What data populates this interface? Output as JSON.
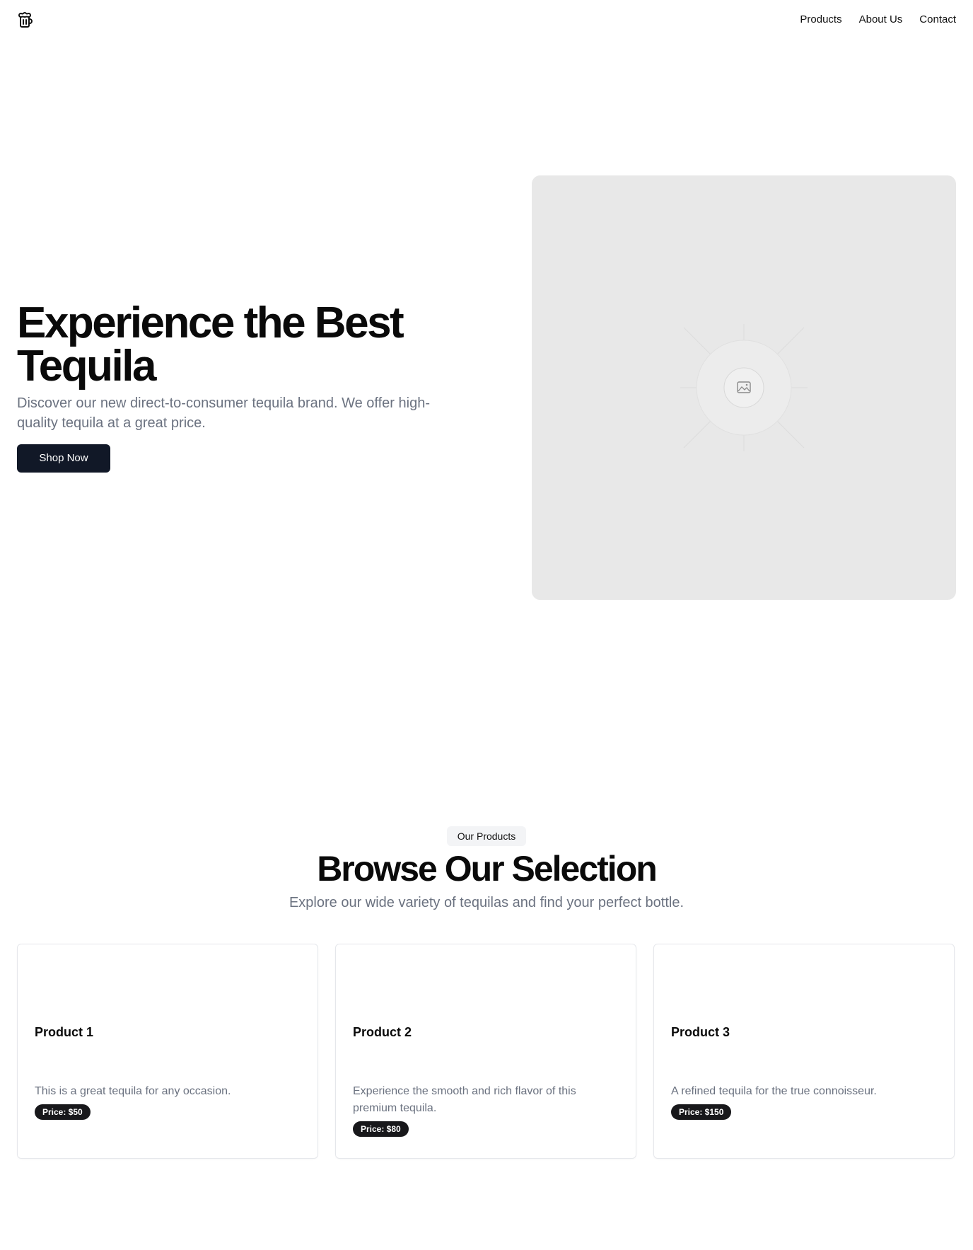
{
  "header": {
    "logo_icon": "beer-mug-icon",
    "nav": [
      {
        "label": "Products"
      },
      {
        "label": "About Us"
      },
      {
        "label": "Contact"
      }
    ]
  },
  "hero": {
    "title": "Experience the Best Tequila",
    "subtitle": "Discover our new direct-to-consumer tequila brand. We offer high-quality tequila at a great price.",
    "cta_label": "Shop Now",
    "image_icon": "image-placeholder-icon"
  },
  "products": {
    "badge": "Our Products",
    "title": "Browse Our Selection",
    "subtitle": "Explore our wide variety of tequilas and find your perfect bottle.",
    "items": [
      {
        "title": "Product 1",
        "description": "This is a great tequila for any occasion.",
        "price": "Price: $50"
      },
      {
        "title": "Product 2",
        "description": "Experience the smooth and rich flavor of this premium tequila.",
        "price": "Price: $80"
      },
      {
        "title": "Product 3",
        "description": "A refined tequila for the true connoisseur.",
        "price": "Price: $150"
      }
    ]
  },
  "colors": {
    "button_bg": "#111827",
    "muted_text": "#6b7280",
    "placeholder_bg": "#e8e8e8",
    "badge_bg": "#18181b"
  }
}
